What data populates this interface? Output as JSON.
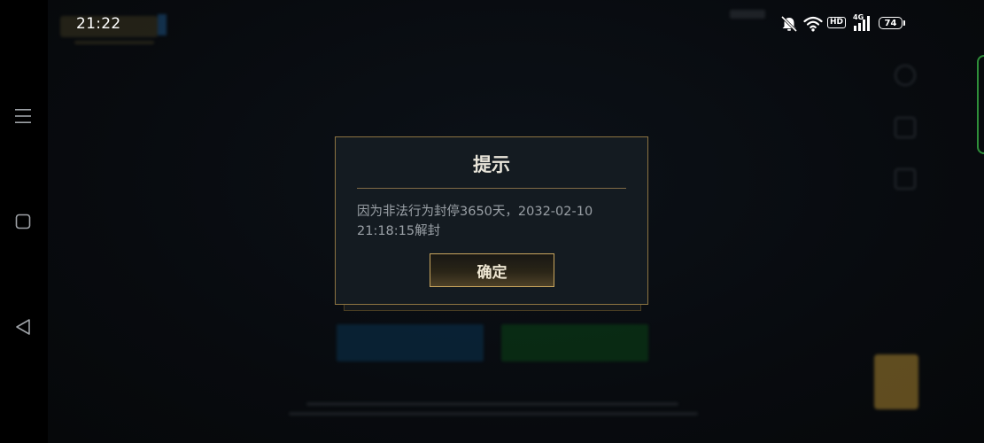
{
  "status_bar": {
    "time": "21:22",
    "hd_badge": "HD",
    "network": "4G",
    "battery": "74",
    "icons": [
      "mute-icon",
      "wifi-icon",
      "signal-icon",
      "battery-icon"
    ]
  },
  "navigation": {
    "items": [
      "menu-icon",
      "square-icon",
      "back-icon"
    ]
  },
  "dialog": {
    "title": "提示",
    "message": "因为非法行为封停3650天，2032-02-10 21:18:15解封",
    "confirm_label": "确定"
  },
  "colors": {
    "dialog_background": "#141b21",
    "dialog_border": "#8d7442",
    "confirm_border": "#c9a65e",
    "message_text": "#9aa0a6"
  }
}
